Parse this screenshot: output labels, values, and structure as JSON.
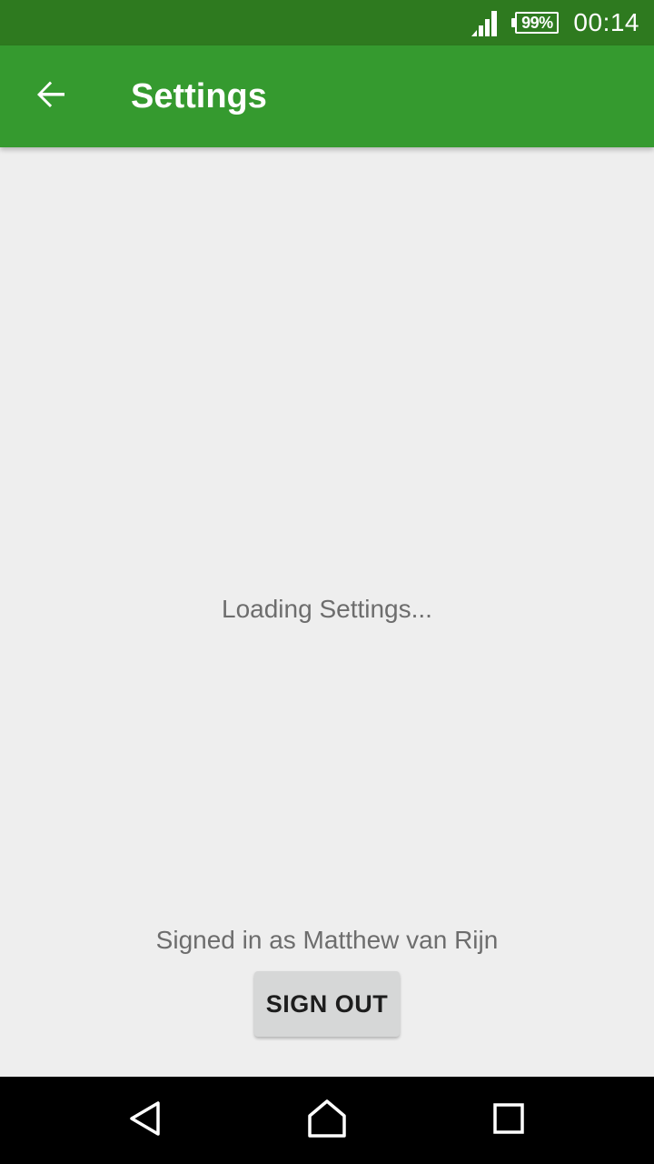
{
  "status_bar": {
    "battery_percent": "99%",
    "time": "00:14",
    "signal_icon": "cell-signal-icon"
  },
  "app_bar": {
    "back_icon": "arrow-back-icon",
    "title": "Settings"
  },
  "content": {
    "loading_message": "Loading Settings...",
    "signed_in_text": "Signed in as Matthew van Rijn",
    "sign_out_label": "SIGN OUT"
  },
  "nav_bar": {
    "back_icon": "nav-back-icon",
    "home_icon": "nav-home-icon",
    "recents_icon": "nav-recents-icon"
  },
  "colors": {
    "status_bar": "#2e7a1f",
    "app_bar": "#359a2f",
    "background": "#eeeeee",
    "button": "#d6d7d7"
  }
}
